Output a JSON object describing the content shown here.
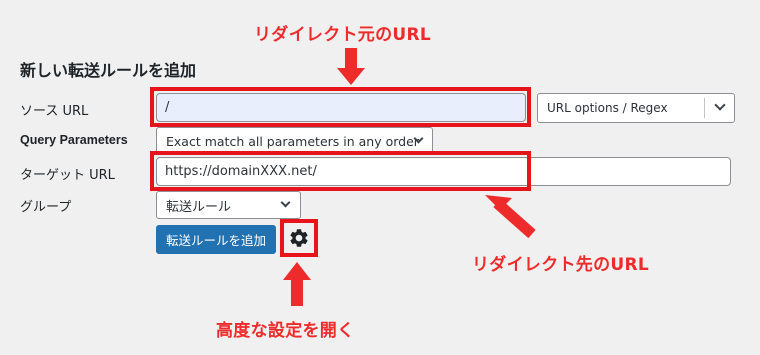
{
  "annotations": {
    "source_url": "リダイレクト元のURL",
    "target_url": "リダイレクト先のURL",
    "advanced": "高度な設定を開く",
    "accent_color": "#ee2b2b"
  },
  "form": {
    "heading": "新しい転送ルールを追加",
    "source_label": "ソース URL",
    "source_value": "/",
    "url_options": "URL options / Regex",
    "query_label": "Query Parameters",
    "query_value": "Exact match all parameters in any order",
    "target_label": "ターゲット URL",
    "target_value": "https://domainXXX.net/",
    "group_label": "グループ",
    "group_value": "転送ルール",
    "add_button": "転送ルールを追加",
    "settings_icon": "gear-icon",
    "primary_color": "#2271b1"
  }
}
